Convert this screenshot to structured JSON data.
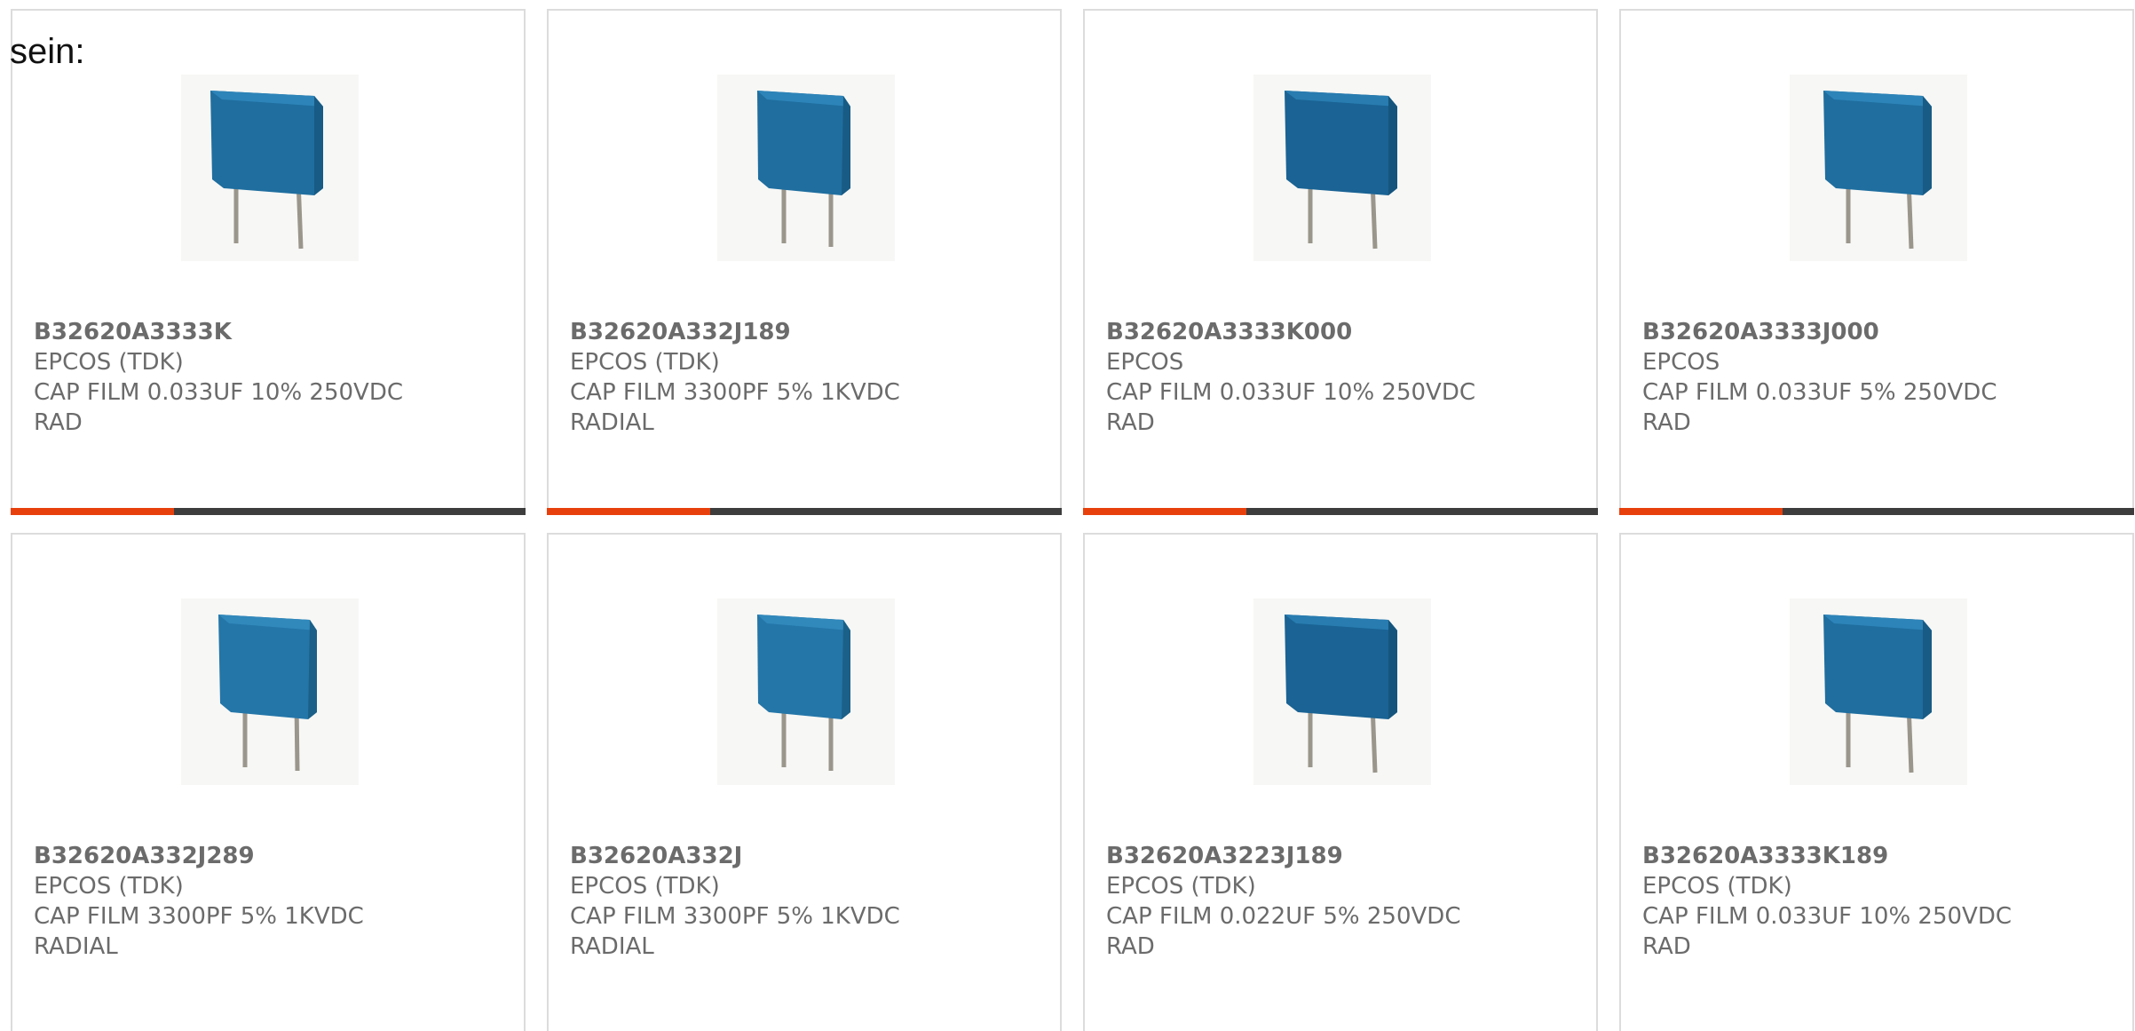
{
  "intro_text": "sein:",
  "colors": {
    "accent": "#e8400c",
    "bar_dark": "#3d3d3d",
    "capacitor_blue": "#1f6e9f"
  },
  "products": [
    {
      "part": "B32620A3333K",
      "maker": "EPCOS (TDK)",
      "desc": "CAP FILM 0.033UF 10% 250VDC",
      "type": "RAD",
      "image": "capacitor-image"
    },
    {
      "part": "B32620A332J189",
      "maker": "EPCOS (TDK)",
      "desc": "CAP FILM 3300PF 5% 1KVDC",
      "type": "RADIAL",
      "image": "capacitor-image"
    },
    {
      "part": "B32620A3333K000",
      "maker": "EPCOS",
      "desc": "CAP FILM 0.033UF 10% 250VDC",
      "type": "RAD",
      "image": "capacitor-image"
    },
    {
      "part": "B32620A3333J000",
      "maker": "EPCOS",
      "desc": "CAP FILM 0.033UF 5% 250VDC",
      "type": "RAD",
      "image": "capacitor-image"
    },
    {
      "part": "B32620A332J289",
      "maker": "EPCOS (TDK)",
      "desc": "CAP FILM 3300PF 5% 1KVDC",
      "type": "RADIAL",
      "image": "capacitor-image"
    },
    {
      "part": "B32620A332J",
      "maker": "EPCOS (TDK)",
      "desc": "CAP FILM 3300PF 5% 1KVDC",
      "type": "RADIAL",
      "image": "capacitor-image"
    },
    {
      "part": "B32620A3223J189",
      "maker": "EPCOS (TDK)",
      "desc": "CAP FILM 0.022UF 5% 250VDC",
      "type": "RAD",
      "image": "capacitor-image"
    },
    {
      "part": "B32620A3333K189",
      "maker": "EPCOS (TDK)",
      "desc": "CAP FILM 0.033UF 10% 250VDC",
      "type": "RAD",
      "image": "capacitor-image"
    }
  ]
}
